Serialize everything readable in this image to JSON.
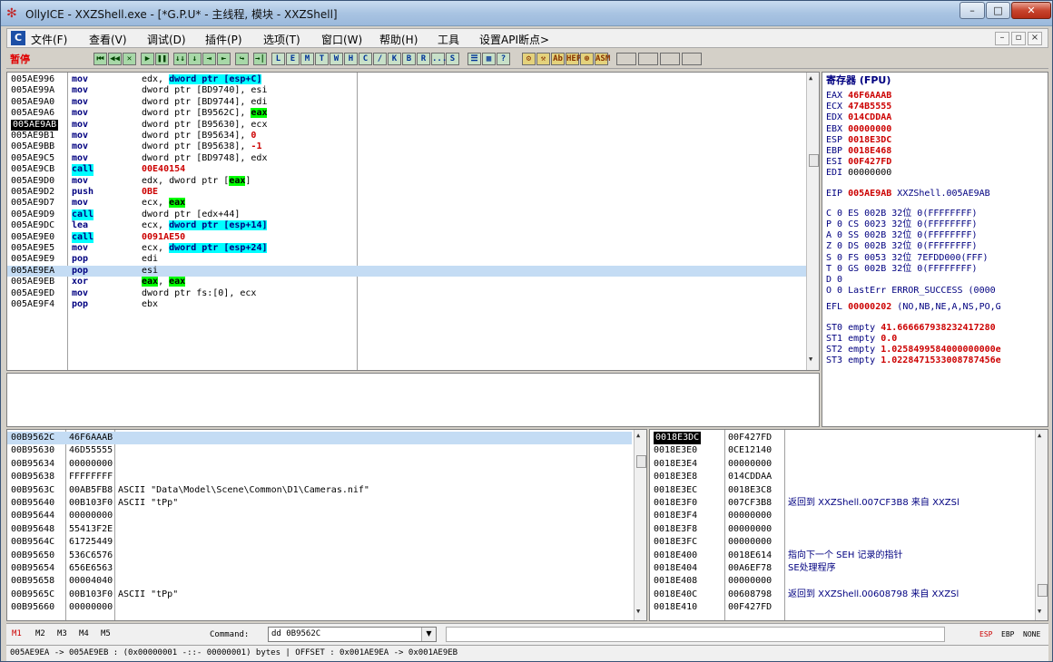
{
  "window": {
    "title": "OllyICE - XXZShell.exe - [*G.P.U* - 主线程, 模块 - XXZShell]",
    "min": "–",
    "max": "□",
    "close": "✕"
  },
  "menu": {
    "icon": "C",
    "items": [
      "文件(F)",
      "查看(V)",
      "调试(D)",
      "插件(P)",
      "选项(T)",
      "窗口(W)",
      "帮助(H)",
      "工具",
      "设置API断点>"
    ],
    "mdi": [
      "–",
      "▫",
      "×"
    ]
  },
  "toolbar": {
    "status": "暂停",
    "buttons_a": [
      "⏮",
      "◀◀",
      "✕",
      "▶",
      "❚❚",
      "↓↓",
      "↓",
      "⇥",
      "⇤",
      "↪",
      "→|"
    ],
    "letters": [
      "L",
      "E",
      "M",
      "T",
      "W",
      "H",
      "C",
      "/",
      "K",
      "B",
      "R",
      "...",
      "S"
    ],
    "buttons_b": [
      "☰",
      "▦",
      "?"
    ],
    "buttons_c": [
      "⚙",
      "⚒",
      "Ab",
      "HEP",
      "⊕",
      "ASM"
    ]
  },
  "disasm": {
    "rows": [
      {
        "addr": "005AE996",
        "mn": "mov",
        "op": [
          [
            "edx, ",
            ""
          ],
          [
            "dword ptr [esp+C]",
            "cyan"
          ]
        ]
      },
      {
        "addr": "005AE99A",
        "mn": "mov",
        "op": [
          [
            "dword ptr [BD9740], esi",
            ""
          ]
        ]
      },
      {
        "addr": "005AE9A0",
        "mn": "mov",
        "op": [
          [
            "dword ptr [BD9744], edi",
            ""
          ]
        ]
      },
      {
        "addr": "005AE9A6",
        "mn": "mov",
        "op": [
          [
            "dword ptr [B9562C], ",
            ""
          ],
          [
            "eax",
            "green"
          ]
        ]
      },
      {
        "addr": "005AE9AB",
        "mn": "mov",
        "op": [
          [
            "dword ptr [B95630], ecx",
            ""
          ]
        ],
        "current": true
      },
      {
        "addr": "005AE9B1",
        "mn": "mov",
        "op": [
          [
            "dword ptr [B95634], ",
            ""
          ],
          [
            "0",
            "red"
          ]
        ]
      },
      {
        "addr": "005AE9BB",
        "mn": "mov",
        "op": [
          [
            "dword ptr [B95638], ",
            ""
          ],
          [
            "-1",
            "red"
          ]
        ]
      },
      {
        "addr": "005AE9C5",
        "mn": "mov",
        "op": [
          [
            "dword ptr [BD9748], edx",
            ""
          ]
        ]
      },
      {
        "addr": "005AE9CB",
        "mn": "call",
        "op": [
          [
            "00E40154",
            "red"
          ]
        ],
        "call": true
      },
      {
        "addr": "005AE9D0",
        "mn": "mov",
        "op": [
          [
            "edx, dword ptr [",
            ""
          ],
          [
            "eax",
            "green"
          ],
          [
            "]",
            ""
          ]
        ]
      },
      {
        "addr": "005AE9D2",
        "mn": "push",
        "op": [
          [
            "0BE",
            "red"
          ]
        ]
      },
      {
        "addr": "005AE9D7",
        "mn": "mov",
        "op": [
          [
            "ecx, ",
            ""
          ],
          [
            "eax",
            "green"
          ]
        ]
      },
      {
        "addr": "005AE9D9",
        "mn": "call",
        "op": [
          [
            "dword ptr [edx+44]",
            ""
          ]
        ],
        "call": true
      },
      {
        "addr": "005AE9DC",
        "mn": "lea",
        "op": [
          [
            "ecx, ",
            ""
          ],
          [
            "dword ptr [esp+14]",
            "cyan"
          ]
        ]
      },
      {
        "addr": "005AE9E0",
        "mn": "call",
        "op": [
          [
            "0091AE50",
            "red"
          ]
        ],
        "call": true
      },
      {
        "addr": "005AE9E5",
        "mn": "mov",
        "op": [
          [
            "ecx, ",
            ""
          ],
          [
            "dword ptr [esp+24]",
            "cyan"
          ]
        ]
      },
      {
        "addr": "005AE9E9",
        "mn": "pop",
        "op": [
          [
            "edi",
            ""
          ]
        ]
      },
      {
        "addr": "005AE9EA",
        "mn": "pop",
        "op": [
          [
            "esi",
            ""
          ]
        ],
        "selected": true
      },
      {
        "addr": "005AE9EB",
        "mn": "xor",
        "op": [
          [
            "eax",
            "green"
          ],
          [
            ", ",
            ""
          ],
          [
            "eax",
            "green"
          ]
        ]
      },
      {
        "addr": "005AE9ED",
        "mn": "mov",
        "op": [
          [
            "dword ptr fs:[0], ecx",
            ""
          ]
        ]
      },
      {
        "addr": "005AE9F4",
        "mn": "pop",
        "op": [
          [
            "ebx",
            ""
          ]
        ]
      }
    ]
  },
  "registers": {
    "header": "寄存器 (FPU)",
    "gp": [
      {
        "name": "EAX",
        "val": "46F6AAAB",
        "red": true,
        "desc": ""
      },
      {
        "name": "ECX",
        "val": "474B5555",
        "red": true,
        "desc": ""
      },
      {
        "name": "EDX",
        "val": "014CDDAA",
        "red": true,
        "desc": ""
      },
      {
        "name": "EBX",
        "val": "00000000",
        "red": true,
        "desc": ""
      },
      {
        "name": "ESP",
        "val": "0018E3DC",
        "red": true,
        "desc": ""
      },
      {
        "name": "EBP",
        "val": "0018E468",
        "red": true,
        "desc": ""
      },
      {
        "name": "ESI",
        "val": "00F427FD",
        "red": true,
        "desc": ""
      },
      {
        "name": "EDI",
        "val": "00000000",
        "red": false,
        "desc": ""
      }
    ],
    "eip": {
      "name": "EIP",
      "val": "005AE9AB",
      "desc": "XXZShell.005AE9AB"
    },
    "flags": [
      "C 0  ES 002B 32位 0(FFFFFFFF)",
      "P 0  CS 0023 32位 0(FFFFFFFF)",
      "A 0  SS 002B 32位 0(FFFFFFFF)",
      "Z 0  DS 002B 32位 0(FFFFFFFF)",
      "S 0  FS 0053 32位 7EFDD000(FFF)",
      "T 0  GS 002B 32位 0(FFFFFFFF)",
      "D 0",
      "O 0  LastErr ERROR_SUCCESS (0000"
    ],
    "efl": {
      "name": "EFL",
      "val": "00000202",
      "desc": "(NO,NB,NE,A,NS,PO,G"
    },
    "fpu": [
      {
        "name": "ST0 empty",
        "val": "41.666667938232417280"
      },
      {
        "name": "ST1 empty",
        "val": "0.0"
      },
      {
        "name": "ST2 empty",
        "val": "1.0258499584000000000e"
      },
      {
        "name": "ST3 empty",
        "val": "1.0228471533008787456e"
      }
    ]
  },
  "dump": {
    "rows": [
      {
        "addr": "00B9562C",
        "val": "46F6AAAB",
        "text": ""
      },
      {
        "addr": "00B95630",
        "val": "46D55555",
        "text": ""
      },
      {
        "addr": "00B95634",
        "val": "00000000",
        "text": ""
      },
      {
        "addr": "00B95638",
        "val": "FFFFFFFF",
        "text": ""
      },
      {
        "addr": "00B9563C",
        "val": "00AB5FB8",
        "text": "ASCII \"Data\\Model\\Scene\\Common\\D1\\Cameras.nif\""
      },
      {
        "addr": "00B95640",
        "val": "00B103F0",
        "text": "ASCII \"tPp\""
      },
      {
        "addr": "00B95644",
        "val": "00000000",
        "text": ""
      },
      {
        "addr": "00B95648",
        "val": "55413F2E",
        "text": ""
      },
      {
        "addr": "00B9564C",
        "val": "61725449",
        "text": ""
      },
      {
        "addr": "00B95650",
        "val": "536C6576",
        "text": ""
      },
      {
        "addr": "00B95654",
        "val": "656E6563",
        "text": ""
      },
      {
        "addr": "00B95658",
        "val": "00004040",
        "text": ""
      },
      {
        "addr": "00B9565C",
        "val": "00B103F0",
        "text": "ASCII \"tPp\""
      },
      {
        "addr": "00B95660",
        "val": "00000000",
        "text": ""
      }
    ]
  },
  "stack": {
    "rows": [
      {
        "addr": "0018E3DC",
        "val": "00F427FD",
        "text": ""
      },
      {
        "addr": "0018E3E0",
        "val": "0CE12140",
        "text": ""
      },
      {
        "addr": "0018E3E4",
        "val": "00000000",
        "text": ""
      },
      {
        "addr": "0018E3E8",
        "val": "014CDDAA",
        "text": ""
      },
      {
        "addr": "0018E3EC",
        "val": "0018E3C8",
        "text": ""
      },
      {
        "addr": "0018E3F0",
        "val": "007CF3B8",
        "text": "返回到 XXZShell.007CF3B8 来自 XXZSl"
      },
      {
        "addr": "0018E3F4",
        "val": "00000000",
        "text": ""
      },
      {
        "addr": "0018E3F8",
        "val": "00000000",
        "text": ""
      },
      {
        "addr": "0018E3FC",
        "val": "00000000",
        "text": ""
      },
      {
        "addr": "0018E400",
        "val": "0018E614",
        "text": "指向下一个 SEH 记录的指针"
      },
      {
        "addr": "0018E404",
        "val": "00A6EF78",
        "text": "SE处理程序"
      },
      {
        "addr": "0018E408",
        "val": "00000000",
        "text": ""
      },
      {
        "addr": "0018E40C",
        "val": "00608798",
        "text": "返回到 XXZShell.00608798 来自 XXZSl"
      },
      {
        "addr": "0018E410",
        "val": "00F427FD",
        "text": ""
      }
    ]
  },
  "command": {
    "marks": [
      "M1",
      "M2",
      "M3",
      "M4",
      "M5"
    ],
    "label": "Command:",
    "value": "dd 0B9562C",
    "right": [
      "ESP",
      "EBP",
      "NONE"
    ]
  },
  "status": {
    "text": "005AE9EA -> 005AE9EB : (0x00000001 -::- 00000001) bytes   |   OFFSET : 0x001AE9EA -> 0x001AE9EB"
  }
}
